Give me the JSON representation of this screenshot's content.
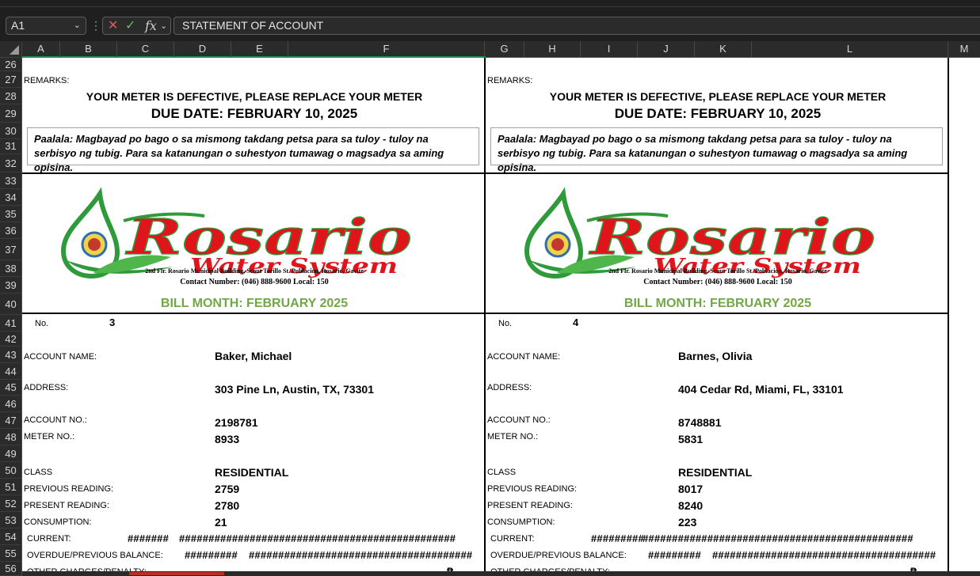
{
  "formula_bar": {
    "cell_ref": "A1",
    "formula_value": "STATEMENT OF ACCOUNT",
    "fx_label": "fx"
  },
  "columns": [
    "A",
    "B",
    "C",
    "D",
    "E",
    "F",
    "G",
    "H",
    "I",
    "J",
    "K",
    "L",
    "M"
  ],
  "rows": [
    "26",
    "27",
    "28",
    "29",
    "30",
    "31",
    "32",
    "33",
    "34",
    "35",
    "36",
    "37",
    "38",
    "39",
    "40",
    "41",
    "42",
    "43",
    "44",
    "45",
    "46",
    "47",
    "48",
    "49",
    "50",
    "51",
    "52",
    "53",
    "54",
    "55",
    "56"
  ],
  "bills": [
    {
      "remarks_label": "REMARKS:",
      "remark": "YOUR METER IS DEFECTIVE, PLEASE REPLACE YOUR METER",
      "due_date": "DUE DATE: FEBRUARY 10, 2025",
      "note": "Paalala: Magbayad po bago o sa mismong takdang petsa para sa tuloy - tuloy na serbisyo ng tubig. Para sa katanungan o suhestyon tumawag o magsadya sa aming opisina.",
      "logo_name": "Rosario",
      "logo_sub": "Water System",
      "office_address": "2nd Flr. Rosario Municipal Building, Scout Torillo St. Poblacion, Rosario, Cavite",
      "contact": "Contact Number: (046) 888-9600  Local: 150",
      "bill_month": "BILL MONTH: FEBRUARY 2025",
      "no_label": "No.",
      "no": "3",
      "account_name_label": "ACCOUNT NAME:",
      "account_name": "Baker, Michael",
      "address_label": "ADDRESS:",
      "address": "303 Pine Ln, Austin, TX, 73301",
      "account_no_label": "ACCOUNT NO.:",
      "account_no": "2198781",
      "meter_no_label": "METER NO.:",
      "meter_no": "8933",
      "class_label": "CLASS",
      "class": "RESIDENTIAL",
      "previous_reading_label": "PREVIOUS READING:",
      "previous_reading": "2759",
      "present_reading_label": "PRESENT READING:",
      "present_reading": "2780",
      "consumption_label": "CONSUMPTION:",
      "consumption": "21",
      "current_label": "CURRENT:",
      "current_hash_1": "#######",
      "current_hash_2": "###############################################",
      "overdue_label": "OVERDUE/PREVIOUS BALANCE:",
      "overdue_hash_1": "#########",
      "overdue_hash_2": "######################################",
      "other_charges_label": "OTHER CHARGES/PENALTY:",
      "currency": "₱"
    },
    {
      "remarks_label": "REMARKS:",
      "remark": "YOUR METER IS DEFECTIVE, PLEASE REPLACE YOUR METER",
      "due_date": "DUE DATE: FEBRUARY 10, 2025",
      "note": "Paalala: Magbayad po bago o sa mismong takdang petsa para sa tuloy - tuloy na serbisyo ng tubig. Para sa katanungan o suhestyon tumawag o magsadya sa aming opisina.",
      "logo_name": "Rosario",
      "logo_sub": "Water System",
      "office_address": "2nd Flr. Rosario Municipal Building, Scout Torillo St. Poblacion, Rosario, Cavite",
      "contact": "Contact Number: (046) 888-9600  Local: 150",
      "bill_month": "BILL MONTH: FEBRUARY 2025",
      "no_label": "No.",
      "no": "4",
      "account_name_label": "ACCOUNT NAME:",
      "account_name": "Barnes, Olivia",
      "address_label": "ADDRESS:",
      "address": "404 Cedar Rd, Miami, FL, 33101",
      "account_no_label": "ACCOUNT NO.:",
      "account_no": "8748881",
      "meter_no_label": "METER NO.:",
      "meter_no": "5831",
      "class_label": "CLASS",
      "class": "RESIDENTIAL",
      "previous_reading_label": "PREVIOUS READING:",
      "previous_reading": "8017",
      "present_reading_label": "PRESENT READING:",
      "present_reading": "8240",
      "consumption_label": "CONSUMPTION:",
      "consumption": "223",
      "current_label": "CURRENT:",
      "current_hash_1": "#########",
      "current_hash_2": "##############################################",
      "overdue_label": "OVERDUE/PREVIOUS BALANCE:",
      "overdue_hash_1": "#########",
      "overdue_hash_2": "######################################",
      "other_charges_label": "OTHER CHARGES/PENALTY:",
      "currency": "₱"
    }
  ],
  "colors": {
    "logo_green": "#2e9a3a",
    "logo_red": "#e0141b",
    "bill_month_green": "#70a845",
    "excel_green": "#1f8f4e"
  }
}
